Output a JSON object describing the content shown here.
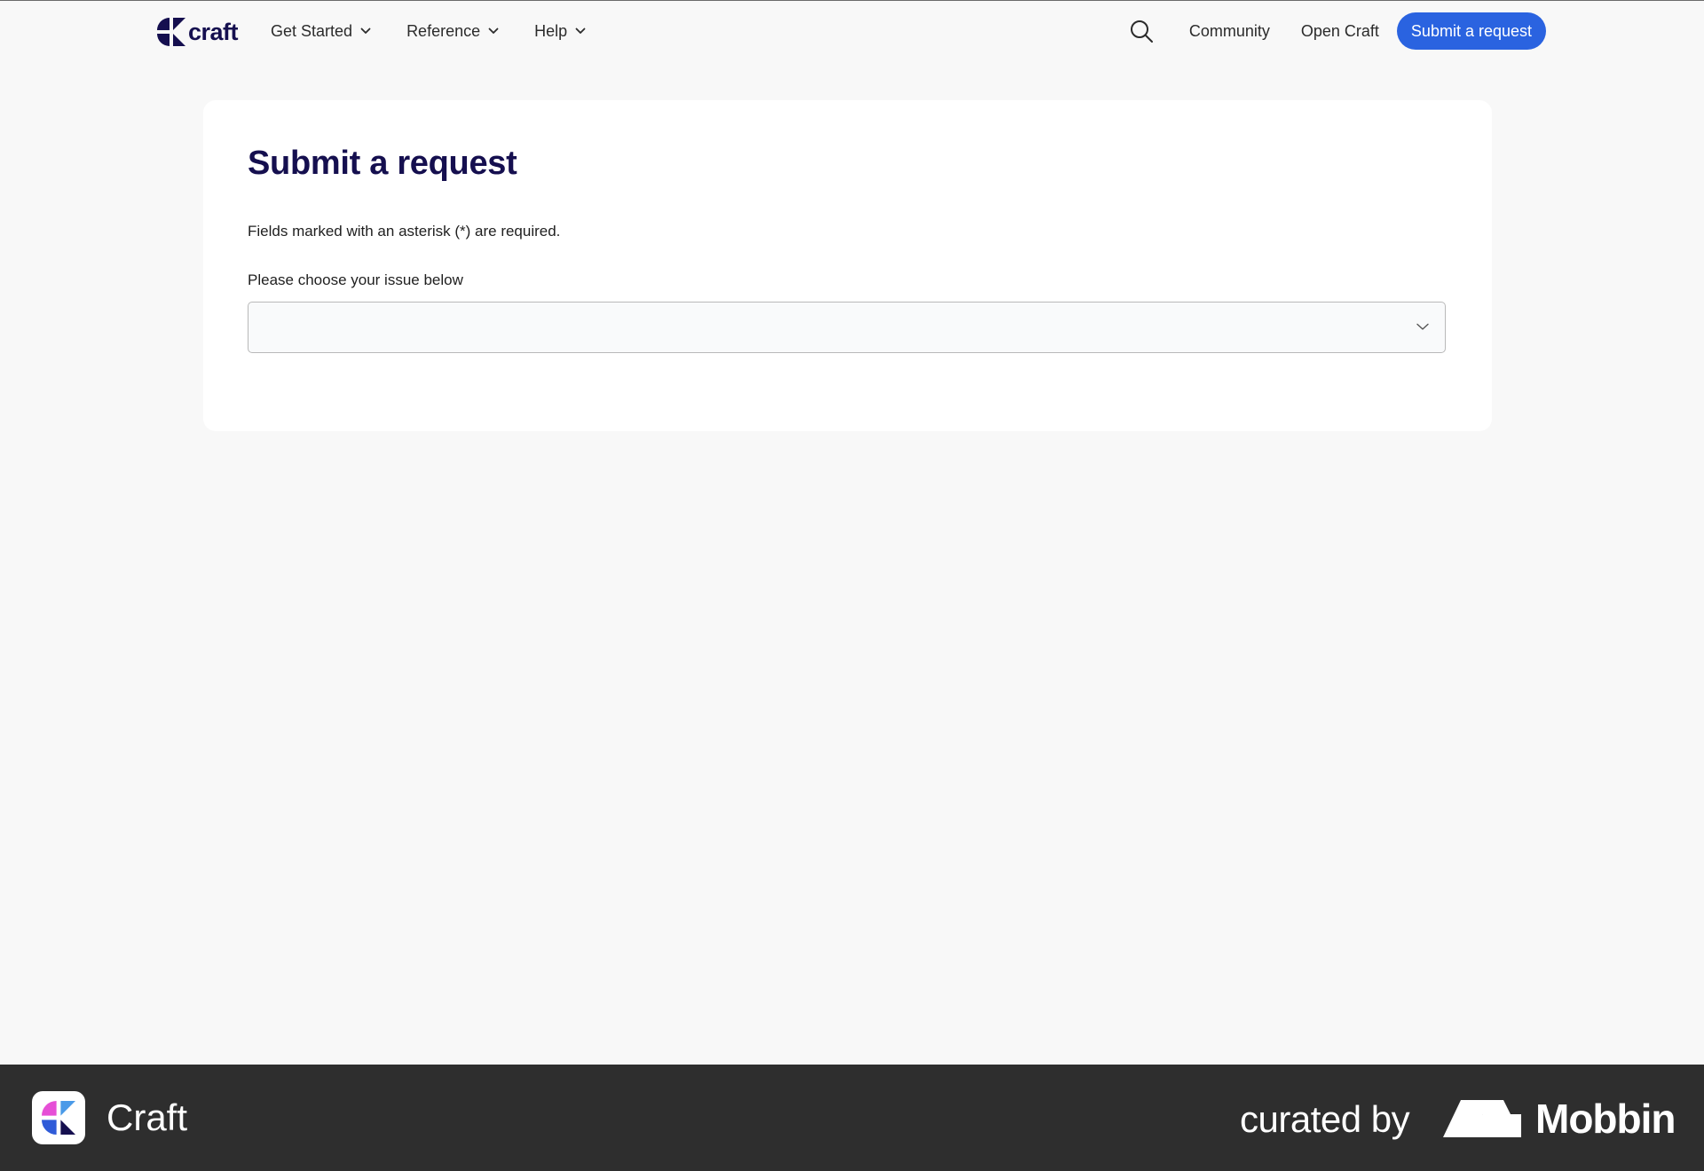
{
  "header": {
    "logo_text": "craft",
    "nav": [
      {
        "label": "Get Started"
      },
      {
        "label": "Reference"
      },
      {
        "label": "Help"
      }
    ],
    "community_label": "Community",
    "open_craft_label": "Open Craft",
    "submit_label": "Submit a request"
  },
  "form": {
    "title": "Submit a request",
    "required_note": "Fields marked with an asterisk (*) are required.",
    "issue_label": "Please choose your issue below",
    "issue_selected": ""
  },
  "footer": {
    "app_name": "Craft",
    "curated_by": "curated by",
    "brand": "Mobbin"
  },
  "colors": {
    "brand_navy": "#150f4f",
    "button_blue": "#2a63e0",
    "page_bg": "#f8f8f8",
    "footer_bg": "#2e2e2e"
  }
}
